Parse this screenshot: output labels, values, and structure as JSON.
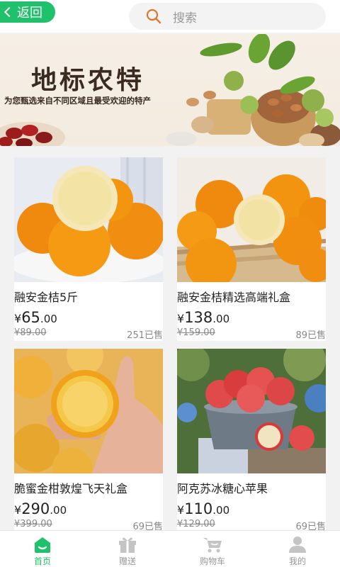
{
  "header": {
    "back_label": "返回",
    "search_placeholder": "搜索"
  },
  "banner": {
    "title": "地标农特",
    "subtitle": "为您甄选来自不同区域且最受欢迎的特产"
  },
  "products": [
    {
      "title": "融安金桔5斤",
      "currency": "¥",
      "price_int": "65",
      "price_dec": ".00",
      "orig_price": "¥89.00",
      "sold": "251已售",
      "image": "kumquat-bowl"
    },
    {
      "title": "融安金桔精选高端礼盒",
      "currency": "¥",
      "price_int": "138",
      "price_dec": ".00",
      "orig_price": "¥159.00",
      "sold": "89已售",
      "image": "kumquat-basket"
    },
    {
      "title": "脆蜜金柑敦煌飞天礼盒",
      "currency": "¥",
      "price_int": "290",
      "price_dec": ".00",
      "orig_price": "¥399.00",
      "sold": "69已售",
      "image": "kumquat-hand"
    },
    {
      "title": "阿克苏冰糖心苹果",
      "currency": "¥",
      "price_int": "110",
      "price_dec": ".00",
      "orig_price": "¥129.00",
      "sold": "69已售",
      "image": "apple-bucket"
    }
  ],
  "tabbar": {
    "items": [
      {
        "label": "首页",
        "icon": "home-icon",
        "active": true
      },
      {
        "label": "赠送",
        "icon": "gift-icon",
        "active": false
      },
      {
        "label": "购物车",
        "icon": "cart-icon",
        "active": false
      },
      {
        "label": "我的",
        "icon": "user-icon",
        "active": false
      }
    ]
  },
  "colors": {
    "accent": "#1fc16b",
    "inactive": "#999999"
  }
}
